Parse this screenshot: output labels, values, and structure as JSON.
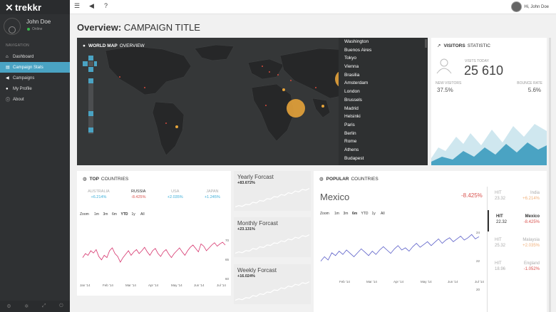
{
  "app": {
    "logo": "trekkr"
  },
  "profile": {
    "name": "John Doe",
    "status": "Online"
  },
  "nav": {
    "header": "NAVIGATION",
    "items": [
      {
        "label": "Dashboard",
        "icon": "home-icon"
      },
      {
        "label": "Campaign Stats",
        "icon": "chart-icon"
      },
      {
        "label": "Campaigns",
        "icon": "megaphone-icon"
      },
      {
        "label": "My Profile",
        "icon": "user-icon"
      },
      {
        "label": "About",
        "icon": "info-icon"
      }
    ]
  },
  "topbar": {
    "greeting": "Hi, John Doe"
  },
  "page": {
    "title_bold": "Overview:",
    "title_rest": "CAMPAIGN TITLE"
  },
  "map": {
    "title_bold": "WORLD MAP",
    "title_rest": "OVERVIEW",
    "cities": [
      "Washington",
      "Buenos Aires",
      "Tokyo",
      "Vienna",
      "Brasilia",
      "Amsterdam",
      "London",
      "Brussels",
      "Madrid",
      "Helsinki",
      "Paris",
      "Berlin",
      "Rome",
      "Athens",
      "Budapest"
    ]
  },
  "visitors": {
    "title_bold": "VISITORS",
    "title_rest": "STATISTIC",
    "visits_label": "VISITS TODAY",
    "visits_value": "25 610",
    "new_label": "NEW VISITORS",
    "new_value": "37.5%",
    "bounce_label": "BOUNCE RATE",
    "bounce_value": "5.6%"
  },
  "top_countries": {
    "title_bold": "TOP",
    "title_rest": "COUNTRIES",
    "items": [
      {
        "name": "AUSTRALIA",
        "value": "+6.214%"
      },
      {
        "name": "RUSSIA",
        "value": "-8.425%"
      },
      {
        "name": "USA",
        "value": "+2.035%"
      },
      {
        "name": "JAPAN",
        "value": "+1.245%"
      }
    ],
    "zoom_label": "Zoom",
    "ranges": [
      "1m",
      "3m",
      "6m",
      "YTD",
      "1y",
      "All"
    ],
    "xticks": [
      "Jan '14",
      "Feb '14",
      "Mar '14",
      "Apr '14",
      "May '14",
      "Jun '14",
      "Jul '14"
    ],
    "yticks": [
      "70",
      "65",
      "60"
    ]
  },
  "forecasts": [
    {
      "title": "Yearly Forcast",
      "value": "+83.672%"
    },
    {
      "title": "Monthly Forcast",
      "value": "+23.131%"
    },
    {
      "title": "Weekly Forcast",
      "value": "+16.024%"
    }
  ],
  "popular": {
    "title_bold": "POPULAR",
    "title_rest": "COUNTRIES",
    "country": "Mexico",
    "change": "-8.425%",
    "zoom_label": "Zoom",
    "ranges": [
      "1m",
      "3m",
      "6m",
      "YTD",
      "1y",
      "All"
    ],
    "xticks": [
      "Feb '14",
      "Mar '14",
      "Apr '14",
      "May '14",
      "Jun '14",
      "Jul '14"
    ],
    "yticks": [
      "24",
      "22",
      "20"
    ],
    "list": [
      {
        "hit": "HIT",
        "num": "23.32",
        "country": "India",
        "value": "+6.214%"
      },
      {
        "hit": "HIT",
        "num": "22.32",
        "country": "Mexico",
        "value": "-8.425%"
      },
      {
        "hit": "HIT",
        "num": "25.32",
        "country": "Malaysia",
        "value": "+2.035%"
      },
      {
        "hit": "HIT",
        "num": "18.96",
        "country": "England",
        "value": "-1.052%"
      }
    ]
  },
  "colors": {
    "accent": "#4aa3c3",
    "map_marker": "#e5a33a",
    "neg": "#d9534f",
    "pos": "#3aaed8",
    "line_red": "#d6336c",
    "line_blue": "#5a5ec8"
  }
}
